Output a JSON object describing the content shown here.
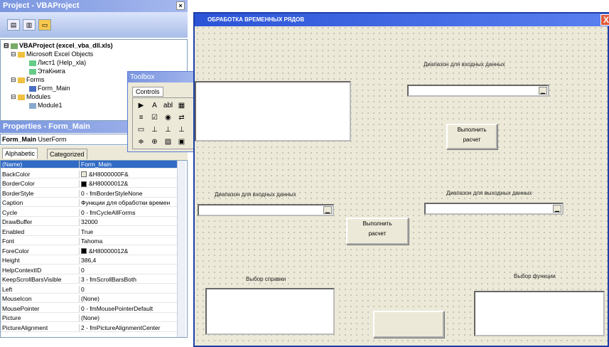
{
  "project": {
    "title": "Project - VBAProject",
    "close": "×",
    "tree": [
      {
        "label": "VBAProject (excel_vba_dll.xls)",
        "bold": true
      },
      {
        "label": "Microsoft Excel Objects"
      },
      {
        "label": "Лист1 (Help_xla)"
      },
      {
        "label": "ЭтаКнига"
      },
      {
        "label": "Forms"
      },
      {
        "label": "Form_Main"
      },
      {
        "label": "Modules"
      },
      {
        "label": "Module1"
      }
    ]
  },
  "toolbox": {
    "title": "Toolbox",
    "tab": "Controls",
    "close": "×",
    "tools": [
      "▶",
      "A",
      "abl",
      "▦",
      "≡",
      "☑",
      "◉",
      "⇄",
      "▭",
      "⊥",
      "⊥",
      "⊥",
      "≑",
      "⊕",
      "▨",
      "▣"
    ]
  },
  "properties": {
    "title": "Properties - Form_Main",
    "object_name": "Form_Main",
    "object_type": "UserForm",
    "tabs": [
      "Alphabetic",
      "Categorized"
    ],
    "rows": [
      {
        "name": "(Name)",
        "value": "Form_Main"
      },
      {
        "name": "BackColor",
        "value": "&H8000000F&",
        "swatch": "#ece9d8"
      },
      {
        "name": "BorderColor",
        "value": "&H80000012&",
        "swatch": "#000000"
      },
      {
        "name": "BorderStyle",
        "value": "0 - fmBorderStyleNone"
      },
      {
        "name": "Caption",
        "value": "Функции для обработки времен"
      },
      {
        "name": "Cycle",
        "value": "0 - fmCycleAllForms"
      },
      {
        "name": "DrawBuffer",
        "value": "32000"
      },
      {
        "name": "Enabled",
        "value": "True"
      },
      {
        "name": "Font",
        "value": "Tahoma"
      },
      {
        "name": "ForeColor",
        "value": "&H80000012&",
        "swatch": "#000000"
      },
      {
        "name": "Height",
        "value": "386,4"
      },
      {
        "name": "HelpContextID",
        "value": "0"
      },
      {
        "name": "KeepScrollBarsVisible",
        "value": "3 - fmScrollBarsBoth"
      },
      {
        "name": "Left",
        "value": "0"
      },
      {
        "name": "MouseIcon",
        "value": "(None)"
      },
      {
        "name": "MousePointer",
        "value": "0 - fmMousePointerDefault"
      },
      {
        "name": "Picture",
        "value": "(None)"
      },
      {
        "name": "PictureAlignment",
        "value": "2 - fmPictureAlignmentCenter"
      }
    ]
  },
  "form": {
    "title": "ОБРАБОТКА ВРЕМЕННЫХ РЯДОВ",
    "close": "X",
    "label_input1": "Диапазон для входных данных",
    "label_input2": "Диапазон для входных данных",
    "label_output": "Диапазон для выходных данных",
    "label_help": "Выбор справки",
    "label_func": "Выбор функции",
    "run_button1": [
      "Выполнить",
      "расчет"
    ],
    "run_button2": [
      "Выполнить",
      "расчет"
    ],
    "combo_arrow": "▁"
  }
}
